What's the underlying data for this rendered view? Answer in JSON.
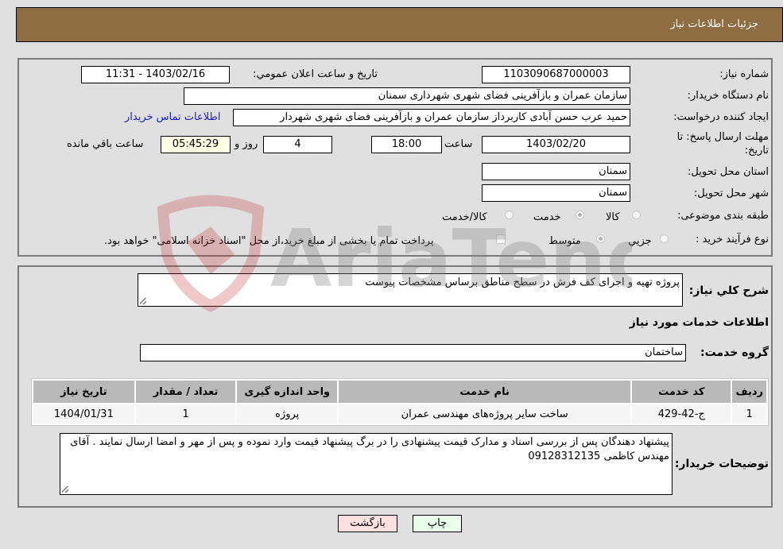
{
  "header": {
    "title": "جزئیات اطلاعات نیاز"
  },
  "form": {
    "need_number": {
      "label": "شماره نیاز:",
      "value": "1103090687000003"
    },
    "announce_datetime": {
      "label": "تاریخ و ساعت اعلان عمومي:",
      "value": "1403/02/16 - 11:31"
    },
    "buyer_org": {
      "label": "نام دستگاه خریدار:",
      "value": "سازمان عمران و بازآفرینی فضای شهری شهرداری سمنان"
    },
    "requester": {
      "label": "ایجاد کننده درخواست:",
      "value": "حمید عرب حسن آبادی کاربرداز سازمان عمران و بازآفرینی فضای شهری شهردار"
    },
    "buyer_contact_link": "اطلاعات تماس خریدار",
    "deadline": {
      "label_line1": "مهلت ارسال پاسخ: تا",
      "label_line2": "تاریخ:",
      "date": "1403/02/20",
      "time_label": "ساعت",
      "time": "18:00",
      "days": "4",
      "days_label": "روز و",
      "remaining": "05:45:29",
      "remaining_label": "ساعت باقي مانده"
    },
    "delivery_province": {
      "label": "استان محل تحویل:",
      "value": "سمنان"
    },
    "delivery_city": {
      "label": "شهر محل تحویل:",
      "value": "سمنان"
    },
    "category": {
      "label": "طبقه بندی موضوعی:",
      "options": [
        {
          "label": "کالا",
          "checked": false
        },
        {
          "label": "خدمت",
          "checked": true
        },
        {
          "label": "کالا/خدمت",
          "checked": false
        }
      ]
    },
    "purchase_type": {
      "label": "نوع فرآیند خرید :",
      "options": [
        {
          "label": "جزيي",
          "checked": false
        },
        {
          "label": "متوسط",
          "checked": true
        }
      ],
      "treasury_checkbox_label": "پرداخت تمام یا بخشی از مبلغ خرید،از محل \"اسناد خزانه اسلامی\" خواهد بود.",
      "treasury_checked": false
    }
  },
  "details": {
    "description_label": "شرح کلي نیاز:",
    "description": "پروژه تهیه و اجرای کف فرش در سطح مناطق برساس مشخصات پیوست",
    "services_heading": "اطلاعات خدمات مورد نیاز",
    "service_group_label": "گروه خدمت:",
    "service_group": "ساختمان",
    "table": {
      "headers": [
        "ردیف",
        "کد خدمت",
        "نام خدمت",
        "واحد اندازه گیری",
        "تعداد / مقدار",
        "تاریخ نیاز"
      ],
      "rows": [
        [
          "1",
          "ج-42-429",
          "ساخت سایر پروژه‌های مهندسی عمران",
          "پروژه",
          "1",
          "1404/01/31"
        ]
      ]
    },
    "buyer_notes_label": "توضیحات خریدار:",
    "buyer_notes": "پیشنهاد دهندگان پس از بررسی اسناد و مدارک قیمت پیشنهادی را در برگ پیشنهاد قیمت وارد نموده و پس از مهر و امضا ارسال نمایند . آقای مهندس کاظمی 09128312135"
  },
  "buttons": {
    "print": "چاپ",
    "back": "بازگشت"
  },
  "watermark": {
    "text": "AriaTender.neT"
  },
  "colors": {
    "header_bg": "#8f6d42",
    "link": "#1a1acc",
    "print_bg": "#eaffea",
    "back_bg": "#ffe0e0",
    "remaining_bg": "#ffffe6"
  }
}
